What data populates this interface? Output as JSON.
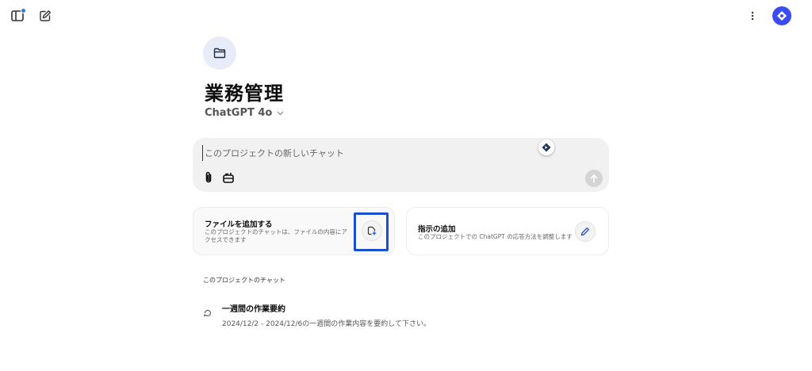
{
  "topbar": {
    "sidebar_icon": "sidebar-toggle-icon",
    "new_chat_icon": "edit-icon",
    "menu_icon": "kebab-menu-icon",
    "avatar_icon": "avatar-icon"
  },
  "project": {
    "folder_icon": "folder-icon",
    "title": "業務管理",
    "model": "ChatGPT 4o"
  },
  "composer": {
    "placeholder": "このプロジェクトの新しいチャット",
    "attach_icon": "paperclip-icon",
    "tools_icon": "toolbox-icon",
    "send_icon": "arrow-up-icon"
  },
  "cards": {
    "files": {
      "title": "ファイルを追加する",
      "description": "このプロジェクトのチャットは、ファイルの内容にアクセスできます"
    },
    "instructions": {
      "title": "指示の追加",
      "description": "このプロジェクトでの ChatGPT の応答方法を調整します"
    }
  },
  "chats": {
    "section_label": "このプロジェクトのチャット",
    "items": [
      {
        "title": "一週間の作業要約",
        "preview": "2024/12/2 - 2024/12/6の一週間の作業内容を要約して下さい。"
      }
    ]
  },
  "colors": {
    "accent": "#3b4cf0",
    "highlight": "#1b4fcf",
    "notification": "#2f7bf5"
  }
}
